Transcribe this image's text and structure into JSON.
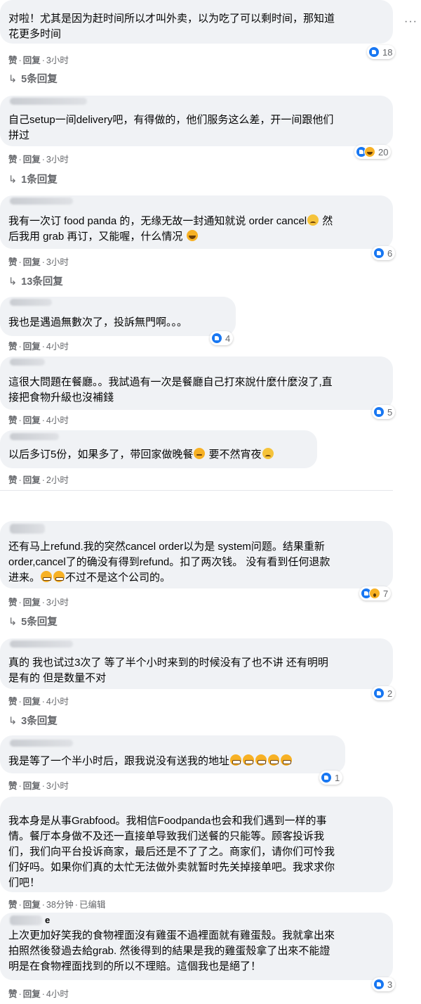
{
  "more_label": "···",
  "comments": [
    {
      "text": "对啦！尤其是因为赶时间所以才叫外卖，以为吃了可以剩时间，那知道\n花更多时间",
      "like": "赞",
      "reply": "回复",
      "time": "3小时",
      "reactions": [
        "like"
      ],
      "count": "18",
      "replies": "5条回复",
      "emoji": []
    },
    {
      "text": "自己setup一间delivery吧，有得做的，他们服务这么差，开一间跟他们\n拼过",
      "like": "赞",
      "reply": "回复",
      "time": "3小时",
      "reactions": [
        "like",
        "haha"
      ],
      "count": "20",
      "replies": "1条回复"
    },
    {
      "text": "我有一次订 food panda 的，无缘无故一封通知就说 order cancel",
      "text2": " 然\n后我用 grab 再订，又能喔，什么情况 ",
      "like": "赞",
      "reply": "回复",
      "time": "3小时",
      "reactions": [
        "like"
      ],
      "count": "6",
      "replies": "13条回复"
    },
    {
      "text": "我也是遇過無數次了，投訴無門啊。。。",
      "like": "赞",
      "reply": "回复",
      "time": "4小时",
      "reactions": [
        "like"
      ],
      "count": "4"
    },
    {
      "text": "這很大問題在餐廳。。我試過有一次是餐廳自己打來說什麼什麼沒了,直\n接把食物升級也沒補錢",
      "like": "赞",
      "reply": "回复",
      "time": "4小时",
      "reactions": [
        "like"
      ],
      "count": "5"
    },
    {
      "text": "以后多订5份，如果多了，带回家做晚餐",
      "text2": " 要不然宵夜",
      "like": "赞",
      "reply": "回复",
      "time": "2小时"
    },
    {
      "text": "还有马上refund.我的突然cancel order以为是 system问题。结果重新\norder,cancel了的确没有得到refund。扣了两次钱。 没有看到任何退款\n进来。",
      "text2": "不过不是这个公司的。",
      "like": "赞",
      "reply": "回复",
      "time": "3小时",
      "reactions": [
        "like",
        "wow"
      ],
      "count": "7",
      "replies": "5条回复"
    },
    {
      "text": "真的 我也试过3次了 等了半个小时来到的时候没有了也不讲 还有明明\n是有的 但是数量不对",
      "like": "赞",
      "reply": "回复",
      "time": "4小时",
      "reactions": [
        "like"
      ],
      "count": "2",
      "replies": "3条回复"
    },
    {
      "text": "我是等了一个半小时后，跟我说没有送我的地址",
      "like": "赞",
      "reply": "回复",
      "time": "3小时",
      "reactions": [
        "like"
      ],
      "count": "1"
    },
    {
      "text": "我本身是从事Grabfood。我相信Foodpanda也会和我们遇到一样的事\n情。餐厅本身做不及还一直接单导致我们送餐的只能等。顾客投诉我\n们，我们向平台投诉商家，最后还是不了了之。商家们，请你们可怜我\n们好吗。如果你们真的太忙无法做外卖就暂时先关掉接单吧。我求求你\n们吧！",
      "like": "赞",
      "reply": "回复",
      "time": "38分钟",
      "edited": "已编辑"
    },
    {
      "author_fragment": "e",
      "text": "上次更加好笑我的食物裡面沒有雞蛋不過裡面就有雞蛋殼。我就拿出來\n拍照然後發過去給grab. 然後得到的結果是我的雞蛋殼拿了出來不能證\n明是在食物裡面找到的所以不理賠。這個我也是絕了！",
      "like": "赞",
      "reply": "回复",
      "time": "4小时",
      "reactions": [
        "like"
      ],
      "count": "3"
    }
  ],
  "colors": {
    "bubble": "#f0f2f5",
    "meta": "#65676b",
    "like_blue": "#1877f2",
    "text": "#050505"
  }
}
